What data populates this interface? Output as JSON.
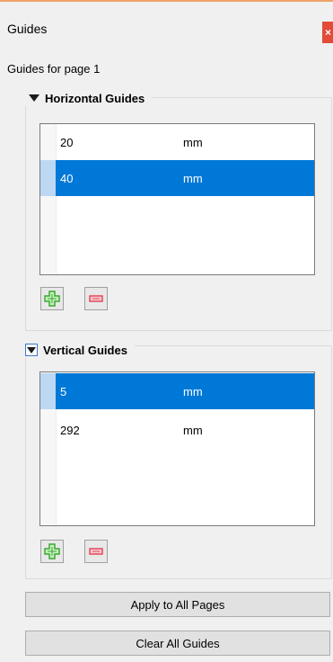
{
  "panel": {
    "title": "Guides",
    "close_glyph": "×",
    "page_label": "Guides for page 1"
  },
  "horizontal": {
    "header": "Horizontal Guides",
    "rows": [
      {
        "value": "20",
        "unit": "mm",
        "selected": false
      },
      {
        "value": "40",
        "unit": "mm",
        "selected": true
      }
    ]
  },
  "vertical": {
    "header": "Vertical Guides",
    "rows": [
      {
        "value": "5",
        "unit": "mm",
        "selected": true
      },
      {
        "value": "292",
        "unit": "mm",
        "selected": false
      }
    ]
  },
  "buttons": {
    "apply_all": "Apply to All Pages",
    "clear_all": "Clear All Guides"
  },
  "icons": {
    "add": "plus-icon",
    "remove": "minus-icon",
    "accent": "#0078d7",
    "add_color": "#3aa832",
    "remove_color": "#e04a5a"
  }
}
